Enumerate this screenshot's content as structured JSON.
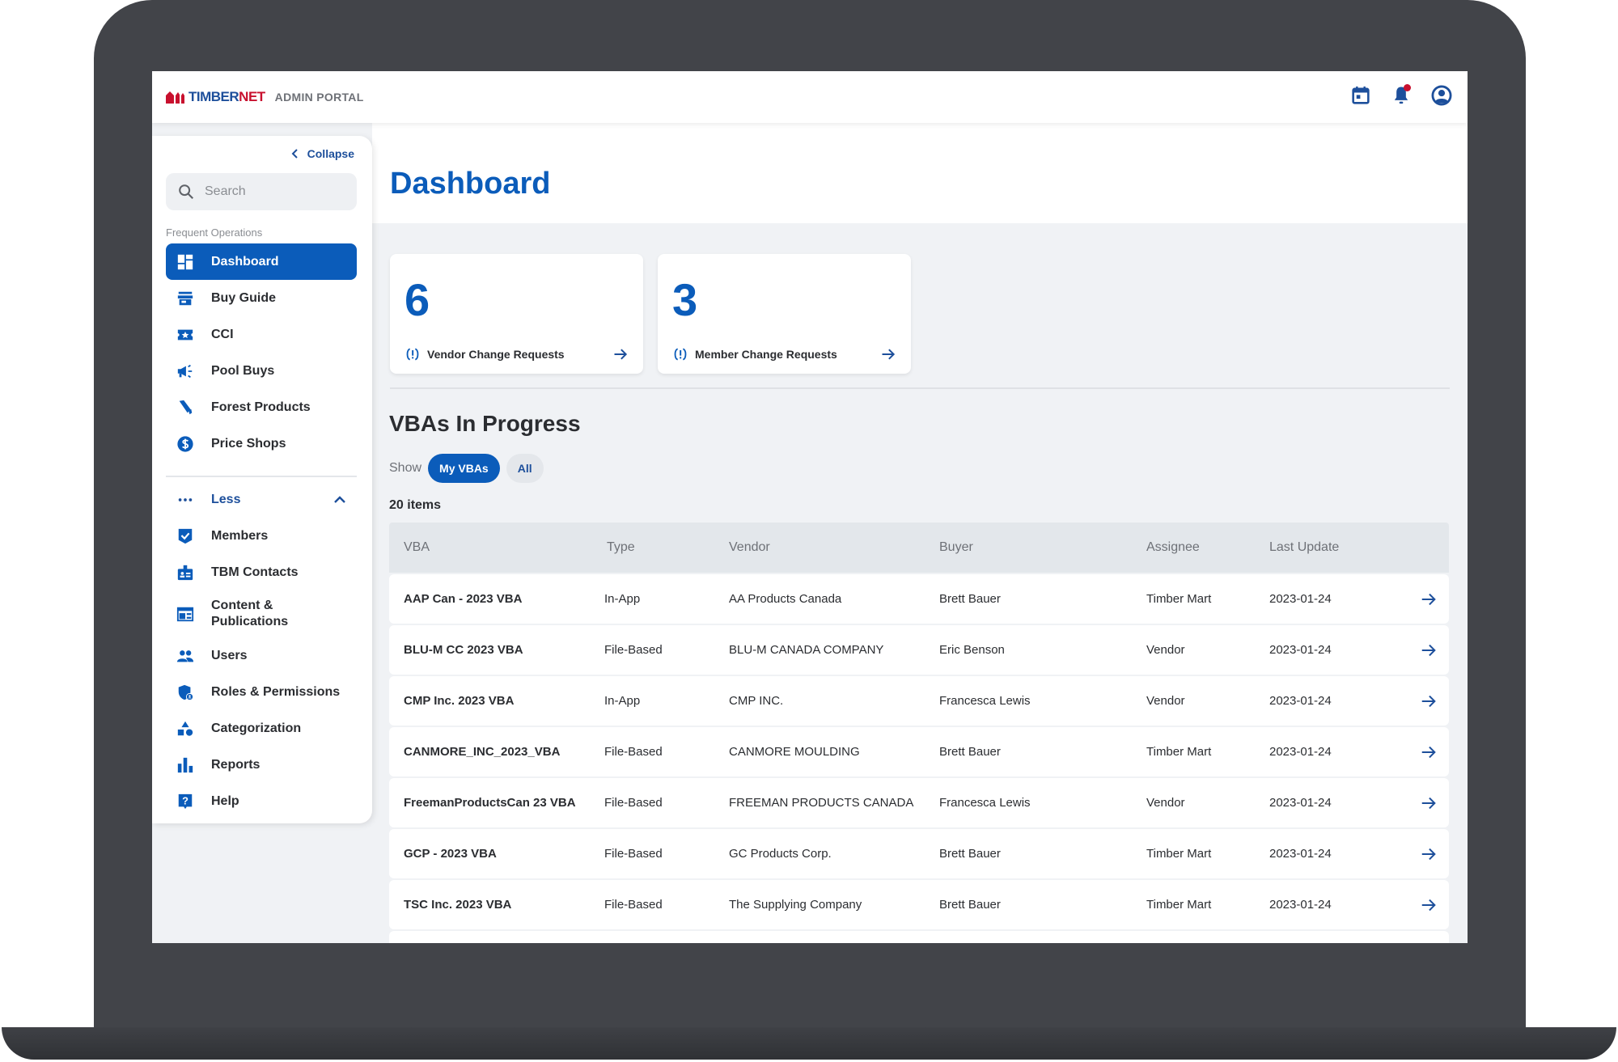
{
  "brand": {
    "name_part1": "TIMBER",
    "name_part2": "NET",
    "subtitle": "ADMIN PORTAL",
    "colors": {
      "primary": "#0b5cba",
      "navy": "#1d4f9b",
      "red": "#c8102e"
    }
  },
  "topbar": {
    "icons": [
      "calendar-icon",
      "bell-icon",
      "account-icon"
    ],
    "notification_dot": true
  },
  "sidebar": {
    "collapse_label": "Collapse",
    "search_placeholder": "Search",
    "section_label": "Frequent Operations",
    "items": [
      {
        "label": "Dashboard",
        "icon": "dashboard-icon",
        "active": true
      },
      {
        "label": "Buy Guide",
        "icon": "store-icon"
      },
      {
        "label": "CCI",
        "icon": "ticket-star-icon"
      },
      {
        "label": "Pool Buys",
        "icon": "megaphone-icon"
      },
      {
        "label": "Forest Products",
        "icon": "flashlight-icon"
      },
      {
        "label": "Price Shops",
        "icon": "dollar-circle-icon"
      }
    ],
    "less_label": "Less",
    "more_items": [
      {
        "label": "Members",
        "icon": "shield-check-icon"
      },
      {
        "label": "TBM Contacts",
        "icon": "badge-icon"
      },
      {
        "label": "Content &",
        "label2": "Publications",
        "icon": "newspaper-icon"
      },
      {
        "label": "Users",
        "icon": "users-icon"
      },
      {
        "label": "Roles & Permissions",
        "icon": "shield-user-icon"
      },
      {
        "label": "Categorization",
        "icon": "shapes-icon"
      },
      {
        "label": "Reports",
        "icon": "bar-chart-icon"
      },
      {
        "label": "Help",
        "icon": "help-icon"
      }
    ]
  },
  "main": {
    "title": "Dashboard",
    "cards": [
      {
        "count": "6",
        "label": "Vendor Change Requests"
      },
      {
        "count": "3",
        "label": "Member Change Requests"
      }
    ],
    "section_title": "VBAs In Progress",
    "show_label": "Show",
    "filters": [
      {
        "label": "My VBAs",
        "selected": true
      },
      {
        "label": "All",
        "selected": false
      }
    ],
    "item_count": "20 items",
    "table": {
      "columns": [
        "VBA",
        "Type",
        "Vendor",
        "Buyer",
        "Assignee",
        "Last Update"
      ],
      "rows": [
        [
          "AAP Can - 2023 VBA",
          "In-App",
          "AA Products Canada",
          "Brett Bauer",
          "Timber Mart",
          "2023-01-24"
        ],
        [
          "BLU-M CC 2023 VBA",
          "File-Based",
          "BLU-M CANADA COMPANY",
          "Eric Benson",
          "Vendor",
          "2023-01-24"
        ],
        [
          "CMP Inc. 2023 VBA",
          "In-App",
          "CMP INC.",
          "Francesca Lewis",
          "Vendor",
          "2023-01-24"
        ],
        [
          "CANMORE_INC_2023_VBA",
          "File-Based",
          "CANMORE MOULDING",
          "Brett Bauer",
          "Timber Mart",
          "2023-01-24"
        ],
        [
          "FreemanProductsCan 23 VBA",
          "File-Based",
          "FREEMAN PRODUCTS CANADA",
          "Francesca Lewis",
          "Vendor",
          "2023-01-24"
        ],
        [
          "GCP - 2023 VBA",
          "File-Based",
          "GC Products Corp.",
          "Brett Bauer",
          "Timber Mart",
          "2023-01-24"
        ],
        [
          "TSC Inc. 2023 VBA",
          "File-Based",
          "The Supplying Company",
          "Brett Bauer",
          "Timber Mart",
          "2023-01-24"
        ]
      ]
    }
  }
}
